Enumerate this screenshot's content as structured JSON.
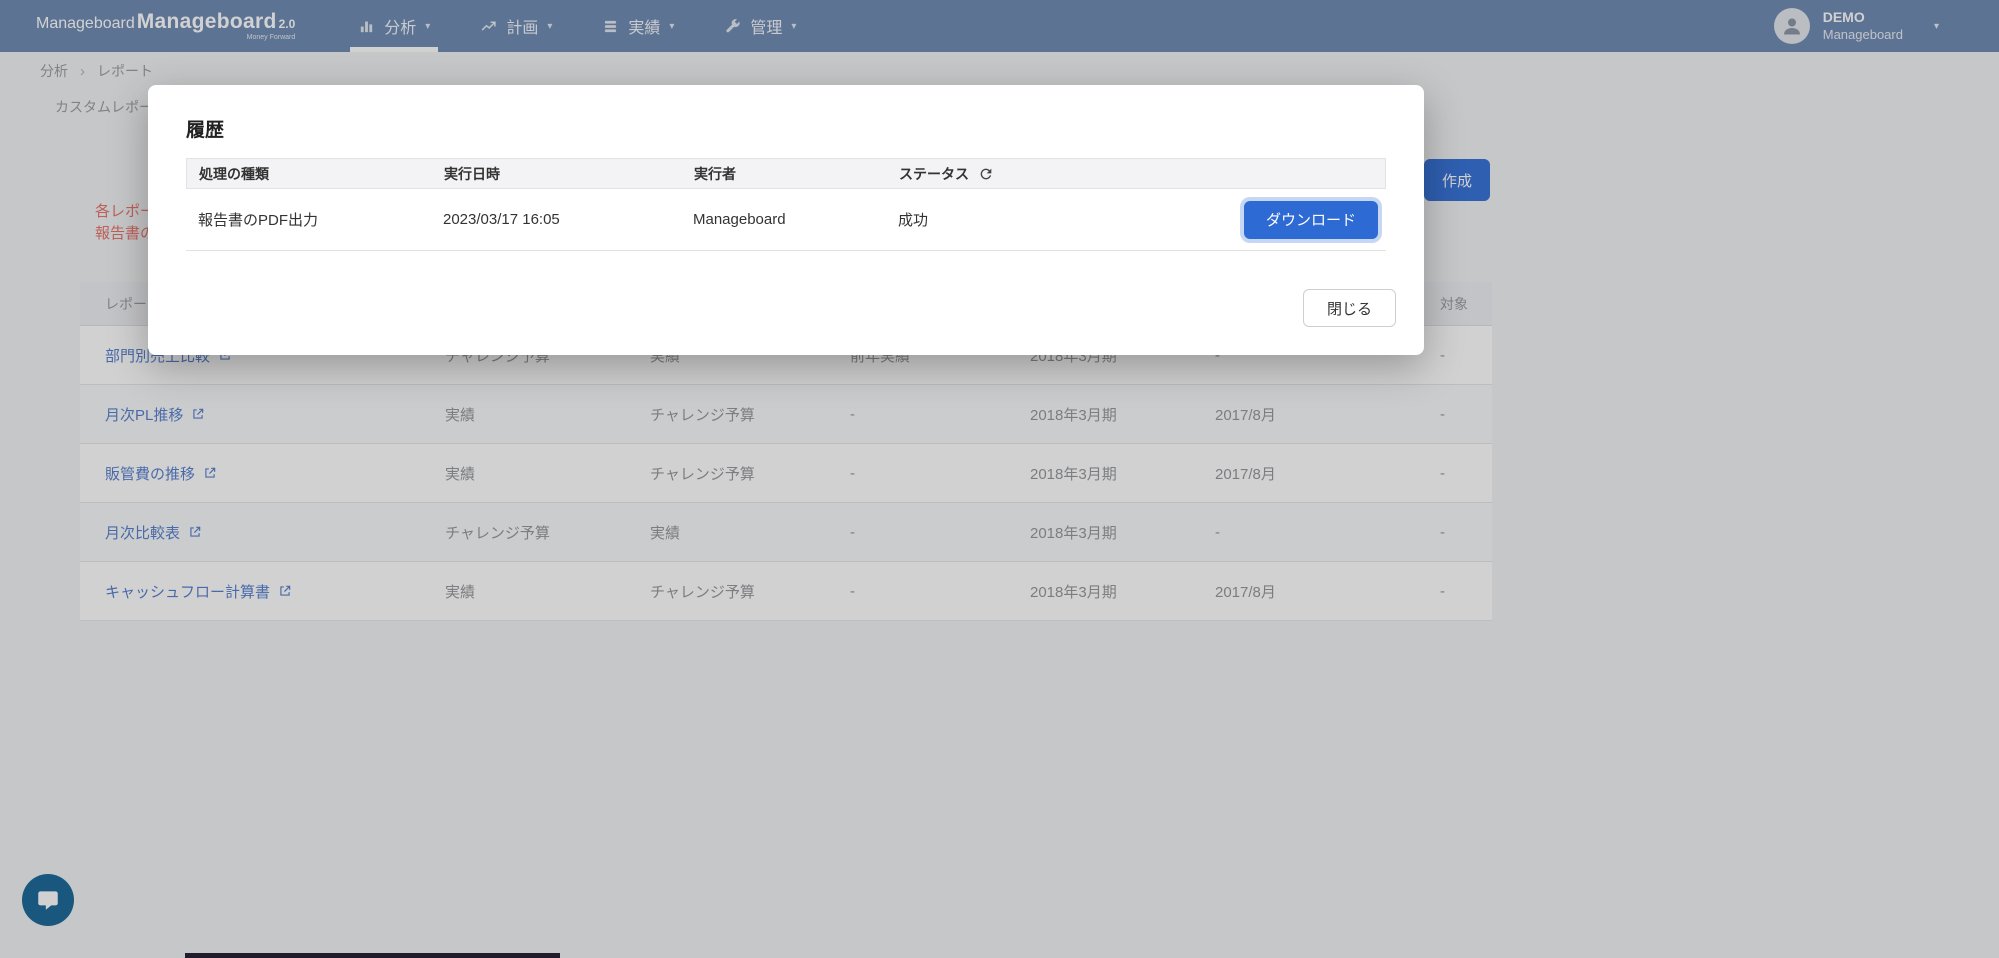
{
  "nav": {
    "logo": {
      "name": "Manageboard",
      "version": "2.0",
      "tagline": "Money Forward"
    },
    "items": [
      {
        "label": "分析",
        "icon": "bar-chart-icon",
        "active": true
      },
      {
        "label": "計画",
        "icon": "line-chart-icon",
        "active": false
      },
      {
        "label": "実績",
        "icon": "stacked-coins-icon",
        "active": false
      },
      {
        "label": "管理",
        "icon": "wrench-icon",
        "active": false
      }
    ],
    "user": {
      "name": "DEMO",
      "org": "Manageboard"
    }
  },
  "breadcrumb": {
    "first": "分析",
    "second": "レポート"
  },
  "tabs": {
    "custom_report": "カスタムレポー"
  },
  "page": {
    "description_line1": "各レポート",
    "description_line2": "報告書の表",
    "create_button": "作成",
    "table": {
      "header_name": "レポー",
      "header_target": "対象",
      "rows": [
        {
          "name": "部門別売上比較",
          "c2": "チャレンジ予算",
          "c3": "実績",
          "c4": "前年実績",
          "c5": "2018年3月期",
          "c6": "-",
          "c7": "-"
        },
        {
          "name": "月次PL推移",
          "c2": "実績",
          "c3": "チャレンジ予算",
          "c4": "-",
          "c5": "2018年3月期",
          "c6": "2017/8月",
          "c7": "-"
        },
        {
          "name": "販管費の推移",
          "c2": "実績",
          "c3": "チャレンジ予算",
          "c4": "-",
          "c5": "2018年3月期",
          "c6": "2017/8月",
          "c7": "-"
        },
        {
          "name": "月次比較表",
          "c2": "チャレンジ予算",
          "c3": "実績",
          "c4": "-",
          "c5": "2018年3月期",
          "c6": "-",
          "c7": "-"
        },
        {
          "name": "キャッシュフロー計算書",
          "c2": "実績",
          "c3": "チャレンジ予算",
          "c4": "-",
          "c5": "2018年3月期",
          "c6": "2017/8月",
          "c7": "-"
        }
      ]
    }
  },
  "modal": {
    "title": "履歴",
    "table": {
      "headers": {
        "type": "処理の種類",
        "datetime": "実行日時",
        "executor": "実行者",
        "status": "ステータス"
      },
      "row": {
        "type": "報告書のPDF出力",
        "datetime": "2023/03/17 16:05",
        "executor": "Manageboard",
        "status": "成功"
      },
      "download_button": "ダウンロード"
    },
    "close_button": "閉じる"
  },
  "colors": {
    "nav_blue": "#718db5",
    "accent_blue": "#2e6ad3",
    "link_blue": "#5a82d0",
    "warning_red": "#e8746e"
  }
}
